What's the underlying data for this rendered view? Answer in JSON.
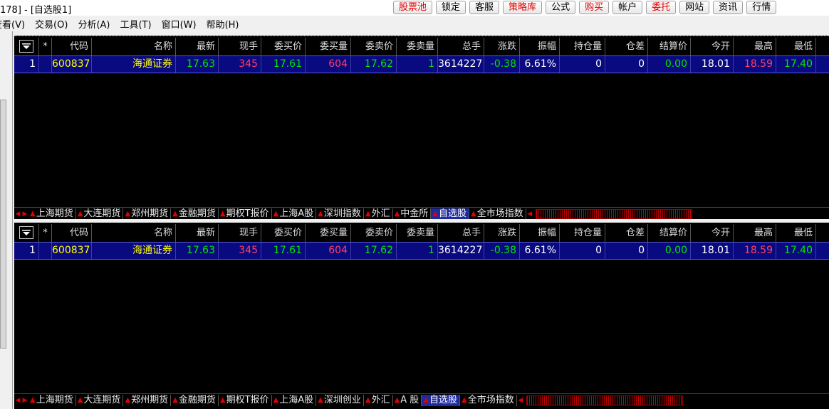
{
  "window": {
    "title": "178] - [自选股1]"
  },
  "top_buttons": [
    {
      "label": "股票池",
      "red": true
    },
    {
      "label": "锁定",
      "red": false
    },
    {
      "label": "客服",
      "red": false
    },
    {
      "label": "策略库",
      "red": true
    },
    {
      "label": "公式",
      "red": false
    },
    {
      "label": "购买",
      "red": true
    },
    {
      "label": "帐户",
      "red": false
    },
    {
      "label": "委托",
      "red": true
    },
    {
      "label": "网站",
      "red": false
    },
    {
      "label": "资讯",
      "red": false
    },
    {
      "label": "行情",
      "red": false
    }
  ],
  "menu": [
    "查看(V)",
    "交易(O)",
    "分析(A)",
    "工具(T)",
    "窗口(W)",
    "帮助(H)"
  ],
  "table": {
    "headers": [
      "",
      "*",
      "代码",
      "名称",
      "最新",
      "现手",
      "委买价",
      "委买量",
      "委卖价",
      "委卖量",
      "总手",
      "涨跌",
      "振幅",
      "持仓量",
      "仓差",
      "结算价",
      "今开",
      "最高",
      "最低"
    ],
    "rows": [
      [
        "1",
        "",
        "600837",
        "海通证券",
        "17.63",
        "345",
        "17.61",
        "604",
        "17.62",
        "1",
        "3614227",
        "-0.38",
        "6.61%",
        "0",
        "0",
        "0.00",
        "18.01",
        "18.59",
        "17.40"
      ]
    ],
    "row_colors": [
      "white",
      "white",
      "yellow",
      "yellow",
      "green",
      "red",
      "green",
      "red",
      "green",
      "green",
      "white",
      "green",
      "white",
      "white",
      "white",
      "green",
      "white",
      "red",
      "green"
    ]
  },
  "tabs_top": [
    "上海期货",
    "大连期货",
    "郑州期货",
    "金融期货",
    "期权T报价",
    "上海A股",
    "深圳指数",
    "外汇",
    "中金所",
    "自选股",
    "全市场指数"
  ],
  "tabs_top_active": 9,
  "tabs_bottom": [
    "上海期货",
    "大连期货",
    "郑州期货",
    "金融期货",
    "期权T报价",
    "上海A股",
    "深圳创业",
    "外汇",
    "A 股",
    "自选股",
    "全市场指数"
  ],
  "tabs_bottom_active": 9,
  "colors": {
    "accent_red": "#e00000",
    "row_bg": "#0a0a80",
    "active_tab": "#1e2aa0"
  }
}
